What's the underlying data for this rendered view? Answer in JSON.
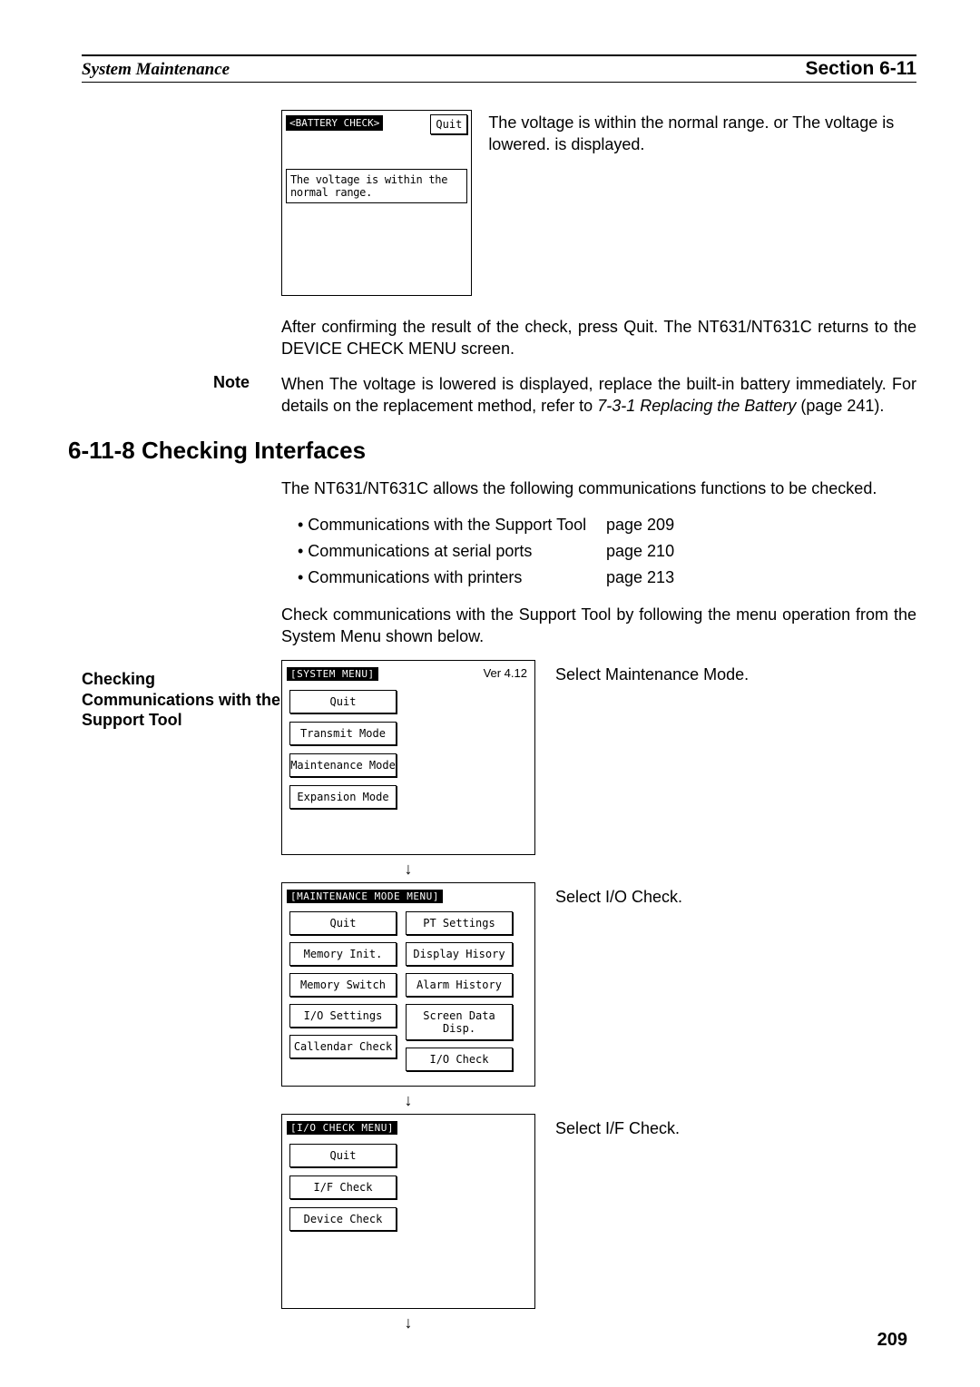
{
  "header": {
    "left": "System Maintenance",
    "right": "Section 6-11"
  },
  "battery_screen": {
    "title": "<BATTERY CHECK>",
    "quit": "Quit",
    "message": "The voltage is within the normal range."
  },
  "battery_caption": "The voltage is within the normal range. or The voltage is lowered. is displayed.",
  "after_confirm": "After confirming the result of the check, press Quit. The NT631/NT631C returns to the DEVICE CHECK MENU screen.",
  "note": {
    "label": "Note",
    "body_part1": "When The voltage is lowered is displayed, replace the built-in battery immediately. For details on the replacement method, refer to ",
    "body_italic": "7-3-1 Replacing the Battery",
    "body_part2": " (page 241)."
  },
  "section_heading": "6-11-8   Checking Interfaces",
  "intro_para": "The NT631/NT631C allows the following communications functions to be checked.",
  "checklist": [
    {
      "item": "• Communications with the Support Tool",
      "page": "page 209"
    },
    {
      "item": "• Communications at serial ports",
      "page": "page 210"
    },
    {
      "item": "• Communications with printers",
      "page": "page 213"
    }
  ],
  "side_label": "Checking Communications with the Support Tool",
  "check_intro": "Check communications with the Support Tool by following the menu operation from the System Menu shown below.",
  "system_menu": {
    "title": "[SYSTEM MENU]",
    "version": "Ver 4.12",
    "buttons": [
      "Quit",
      "Transmit Mode",
      "Maintenance Mode",
      "Expansion Mode"
    ],
    "caption": "Select Maintenance Mode."
  },
  "maint_menu": {
    "title": "[MAINTENANCE MODE MENU]",
    "left_buttons": [
      "Quit",
      "Memory Init.",
      "Memory Switch",
      "I/O Settings",
      "Callendar Check"
    ],
    "right_buttons": [
      "PT Settings",
      "Display Hisory",
      "Alarm History",
      "Screen Data Disp.",
      "I/O Check"
    ],
    "caption": "Select I/O Check."
  },
  "io_menu": {
    "title": "[I/O CHECK MENU]",
    "buttons": [
      "Quit",
      "I/F Check",
      "Device Check"
    ],
    "caption": "Select I/F Check."
  },
  "arrow": "↓",
  "page_number": "209"
}
